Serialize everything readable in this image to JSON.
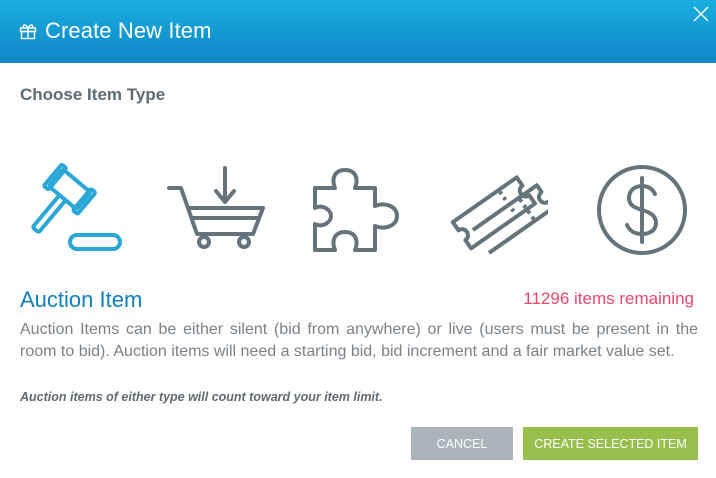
{
  "dialog": {
    "title": "Create New Item",
    "header_icon": "gift-icon",
    "close_icon": "close-icon"
  },
  "section": {
    "label": "Choose Item Type"
  },
  "item_types": [
    {
      "icon": "gavel-icon",
      "selected": true
    },
    {
      "icon": "cart-icon",
      "selected": false
    },
    {
      "icon": "puzzle-icon",
      "selected": false
    },
    {
      "icon": "tickets-icon",
      "selected": false
    },
    {
      "icon": "dollar-icon",
      "selected": false
    }
  ],
  "selected": {
    "title": "Auction Item",
    "remaining": "11296 items remaining",
    "description": "Auction Items can be either silent (bid from anywhere) or live (users must be present in the room to bid). Auction items will need a starting bid, bid increment and a fair market value set.",
    "note": "Auction items of either type will count toward your item limit."
  },
  "buttons": {
    "cancel": "Cancel",
    "create": "Create Selected Item"
  },
  "colors": {
    "header_top": "#1aaee0",
    "header_bottom": "#0d86c6",
    "selected_icon": "#2aa7d6",
    "unselected_icon": "#65737c",
    "remaining": "#e8466c",
    "title": "#0f7fbf",
    "cancel_bg": "#a9b4bb",
    "create_bg": "#98bf4b"
  }
}
